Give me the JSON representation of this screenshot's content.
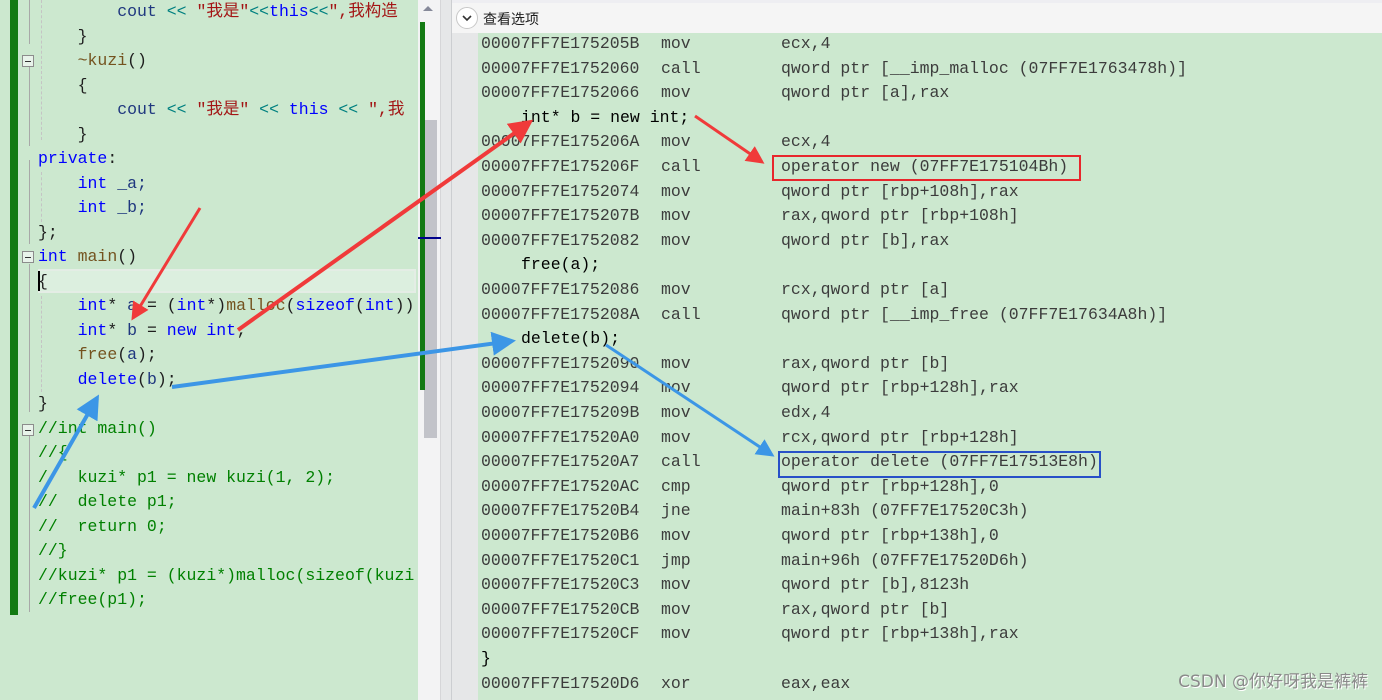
{
  "source_editor": {
    "lines": [
      {
        "indent": "        ",
        "tokens": [
          {
            "t": "cout ",
            "c": "id"
          },
          {
            "t": "<< ",
            "c": "op"
          },
          {
            "t": "\"我是\"",
            "c": "str"
          },
          {
            "t": "<<",
            "c": "op"
          },
          {
            "t": "this",
            "c": "kw"
          },
          {
            "t": "<<",
            "c": "op"
          },
          {
            "t": "\",我构造",
            "c": "str"
          }
        ]
      },
      {
        "indent": "    ",
        "tokens": [
          {
            "t": "}",
            "c": ""
          }
        ]
      },
      {
        "indent": "    ",
        "tokens": [
          {
            "t": "~kuzi",
            "c": "fn"
          },
          {
            "t": "()",
            "c": ""
          }
        ]
      },
      {
        "indent": "    ",
        "tokens": [
          {
            "t": "{",
            "c": ""
          }
        ]
      },
      {
        "indent": "        ",
        "tokens": [
          {
            "t": "cout ",
            "c": "id"
          },
          {
            "t": "<< ",
            "c": "op"
          },
          {
            "t": "\"我是\" ",
            "c": "str"
          },
          {
            "t": "<< ",
            "c": "op"
          },
          {
            "t": "this ",
            "c": "kw"
          },
          {
            "t": "<< ",
            "c": "op"
          },
          {
            "t": "\",我",
            "c": "str"
          }
        ]
      },
      {
        "indent": "    ",
        "tokens": [
          {
            "t": "}",
            "c": ""
          }
        ]
      },
      {
        "indent": "",
        "tokens": [
          {
            "t": "private",
            "c": "kw"
          },
          {
            "t": ":",
            "c": ""
          }
        ]
      },
      {
        "indent": "    ",
        "tokens": [
          {
            "t": "int ",
            "c": "kw"
          },
          {
            "t": "_a;",
            "c": "id"
          }
        ]
      },
      {
        "indent": "    ",
        "tokens": [
          {
            "t": "int ",
            "c": "kw"
          },
          {
            "t": "_b;",
            "c": "id"
          }
        ]
      },
      {
        "indent": "",
        "tokens": [
          {
            "t": "};",
            "c": ""
          }
        ]
      },
      {
        "indent": "",
        "tokens": [
          {
            "t": "int ",
            "c": "kw"
          },
          {
            "t": "main",
            "c": "fn"
          },
          {
            "t": "()",
            "c": ""
          }
        ]
      },
      {
        "indent": "",
        "tokens": [
          {
            "t": "{",
            "c": ""
          }
        ]
      },
      {
        "indent": "    ",
        "tokens": [
          {
            "t": "int",
            "c": "kw"
          },
          {
            "t": "* ",
            "c": ""
          },
          {
            "t": "a ",
            "c": "id"
          },
          {
            "t": "= (",
            "c": ""
          },
          {
            "t": "int",
            "c": "kw"
          },
          {
            "t": "*)",
            "c": ""
          },
          {
            "t": "malloc",
            "c": "fn"
          },
          {
            "t": "(",
            "c": ""
          },
          {
            "t": "sizeof",
            "c": "kw"
          },
          {
            "t": "(",
            "c": ""
          },
          {
            "t": "int",
            "c": "kw"
          },
          {
            "t": "))",
            "c": ""
          }
        ]
      },
      {
        "indent": "    ",
        "tokens": [
          {
            "t": "int",
            "c": "kw"
          },
          {
            "t": "* ",
            "c": ""
          },
          {
            "t": "b ",
            "c": "id"
          },
          {
            "t": "= ",
            "c": ""
          },
          {
            "t": "new int",
            "c": "kw"
          },
          {
            "t": ";",
            "c": ""
          }
        ]
      },
      {
        "indent": "    ",
        "tokens": [
          {
            "t": "free",
            "c": "fn"
          },
          {
            "t": "(",
            "c": ""
          },
          {
            "t": "a",
            "c": "id"
          },
          {
            "t": ");",
            "c": ""
          }
        ]
      },
      {
        "indent": "    ",
        "tokens": [
          {
            "t": "delete",
            "c": "kw"
          },
          {
            "t": "(",
            "c": ""
          },
          {
            "t": "b",
            "c": "id"
          },
          {
            "t": ");",
            "c": ""
          }
        ]
      },
      {
        "indent": "",
        "tokens": [
          {
            "t": "}",
            "c": ""
          }
        ]
      },
      {
        "indent": "",
        "tokens": [
          {
            "t": "//int main()",
            "c": "cm"
          }
        ]
      },
      {
        "indent": "",
        "tokens": [
          {
            "t": "//{",
            "c": "cm"
          }
        ]
      },
      {
        "indent": "",
        "tokens": [
          {
            "t": "//  kuzi* p1 = new kuzi(1, 2);",
            "c": "cm"
          }
        ]
      },
      {
        "indent": "",
        "tokens": [
          {
            "t": "//  delete p1;",
            "c": "cm"
          }
        ]
      },
      {
        "indent": "",
        "tokens": [
          {
            "t": "//  return 0;",
            "c": "cm"
          }
        ]
      },
      {
        "indent": "",
        "tokens": [
          {
            "t": "//}",
            "c": "cm"
          }
        ]
      },
      {
        "indent": "",
        "tokens": [
          {
            "t": "//kuzi* p1 = (kuzi*)malloc(sizeof(kuzi",
            "c": "cm"
          }
        ]
      },
      {
        "indent": "",
        "tokens": [
          {
            "t": "//free(p1);",
            "c": "cm"
          }
        ]
      }
    ]
  },
  "disassembly": {
    "toolbar_label": "查看选项",
    "rows": [
      {
        "addr": "00007FF7E175205B",
        "mn": "mov",
        "op": "ecx,4"
      },
      {
        "addr": "00007FF7E1752060",
        "mn": "call",
        "op": "qword ptr [__imp_malloc (07FF7E1763478h)]"
      },
      {
        "addr": "00007FF7E1752066",
        "mn": "mov",
        "op": "qword ptr [a],rax"
      },
      {
        "src": "int* b = new int;"
      },
      {
        "addr": "00007FF7E175206A",
        "mn": "mov",
        "op": "ecx,4"
      },
      {
        "addr": "00007FF7E175206F",
        "mn": "call",
        "op": "operator new (07FF7E175104Bh)"
      },
      {
        "addr": "00007FF7E1752074",
        "mn": "mov",
        "op": "qword ptr [rbp+108h],rax"
      },
      {
        "addr": "00007FF7E175207B",
        "mn": "mov",
        "op": "rax,qword ptr [rbp+108h]"
      },
      {
        "addr": "00007FF7E1752082",
        "mn": "mov",
        "op": "qword ptr [b],rax"
      },
      {
        "src": "free(a);"
      },
      {
        "addr": "00007FF7E1752086",
        "mn": "mov",
        "op": "rcx,qword ptr [a]"
      },
      {
        "addr": "00007FF7E175208A",
        "mn": "call",
        "op": "qword ptr [__imp_free (07FF7E17634A8h)]"
      },
      {
        "src": "delete(b);"
      },
      {
        "addr": "00007FF7E1752090",
        "mn": "mov",
        "op": "rax,qword ptr [b]"
      },
      {
        "addr": "00007FF7E1752094",
        "mn": "mov",
        "op": "qword ptr [rbp+128h],rax"
      },
      {
        "addr": "00007FF7E175209B",
        "mn": "mov",
        "op": "edx,4"
      },
      {
        "addr": "00007FF7E17520A0",
        "mn": "mov",
        "op": "rcx,qword ptr [rbp+128h]"
      },
      {
        "addr": "00007FF7E17520A7",
        "mn": "call",
        "op": "operator delete (07FF7E17513E8h)"
      },
      {
        "addr": "00007FF7E17520AC",
        "mn": "cmp",
        "op": "qword ptr [rbp+128h],0"
      },
      {
        "addr": "00007FF7E17520B4",
        "mn": "jne",
        "op": "main+83h (07FF7E17520C3h)"
      },
      {
        "addr": "00007FF7E17520B6",
        "mn": "mov",
        "op": "qword ptr [rbp+138h],0"
      },
      {
        "addr": "00007FF7E17520C1",
        "mn": "jmp",
        "op": "main+96h (07FF7E17520D6h)"
      },
      {
        "addr": "00007FF7E17520C3",
        "mn": "mov",
        "op": "qword ptr [b],8123h"
      },
      {
        "addr": "00007FF7E17520CB",
        "mn": "mov",
        "op": "rax,qword ptr [b]"
      },
      {
        "addr": "00007FF7E17520CF",
        "mn": "mov",
        "op": "qword ptr [rbp+138h],rax"
      },
      {
        "brace": "}"
      },
      {
        "addr": "00007FF7E17520D6",
        "mn": "xor",
        "op": "eax,eax"
      }
    ]
  },
  "annotations": {
    "red_box_target": "operator new (07FF7E175104Bh)",
    "blue_box_target": "operator delete (07FF7E17513E8h)",
    "red_color": "#f03a3a",
    "blue_color": "#3c96e6"
  },
  "watermark": "CSDN @你好呀我是裤裤"
}
